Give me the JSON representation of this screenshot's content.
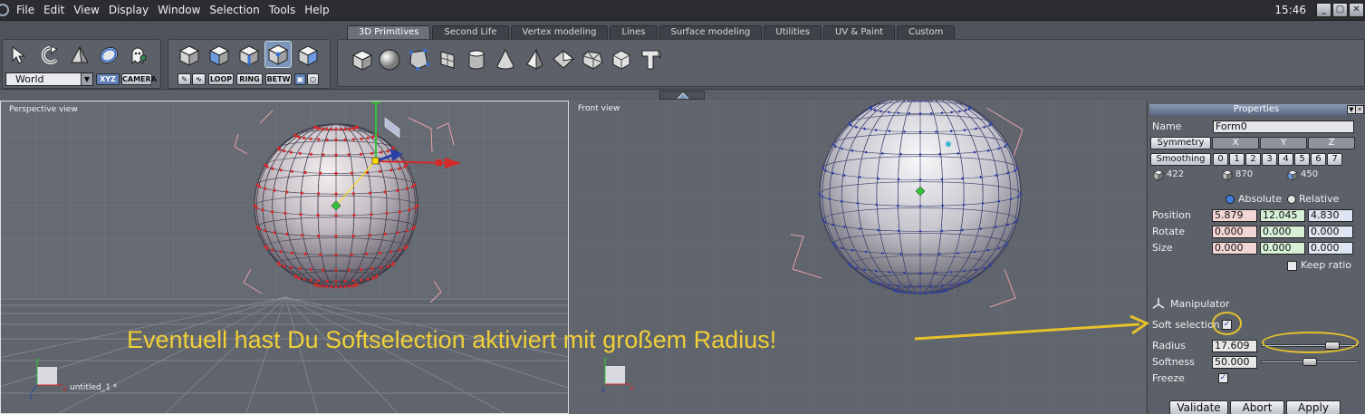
{
  "menubar": {
    "items": [
      "File",
      "Edit",
      "View",
      "Display",
      "Window",
      "Selection",
      "Tools",
      "Help"
    ],
    "clock": "15:46",
    "window_buttons": [
      "_",
      "▢",
      "✕"
    ]
  },
  "toolbar": {
    "tabs": [
      "3D Primitives",
      "Second Life",
      "Vertex modeling",
      "Lines",
      "Surface modeling",
      "Utilities",
      "UV & Paint",
      "Custom"
    ],
    "active_tab": "3D Primitives",
    "coord_space": "World",
    "xyz_label": "XYZ",
    "camera_label": "CAMERA",
    "loop_label": "LOOP",
    "ring_label": "RING",
    "betw_label": "BETW",
    "nav_icons": [
      "arrow-select-icon",
      "rotate-icon",
      "tetra-icon",
      "sphere-select-icon",
      "ghost-icon"
    ],
    "selection_icons": [
      "cube-object-icon",
      "cube-face-icon",
      "cube-edge-icon",
      "cube-vertex-icon",
      "cube-all-icon"
    ],
    "primitive_icons": [
      "cube-icon",
      "sphere-icon",
      "polygon-icon",
      "plane-icon",
      "cylinder-icon",
      "cone-icon",
      "pyramid-icon",
      "diamond-icon",
      "octahedron-icon",
      "icosahedron-icon",
      "text-icon"
    ]
  },
  "viewports": {
    "perspective": {
      "title": "Perspective view",
      "file_label": "untitled_1 *"
    },
    "front": {
      "title": "Front view"
    }
  },
  "properties": {
    "title": "Properties",
    "name_label": "Name",
    "name_value": "Form0",
    "symmetry_label": "Symmetry",
    "symmetry_axes": [
      "X",
      "Y",
      "Z"
    ],
    "smoothing_label": "Smoothing",
    "smoothing_levels": [
      "0",
      "1",
      "2",
      "3",
      "4",
      "5",
      "6",
      "7"
    ],
    "counts": [
      "422",
      "870",
      "450"
    ],
    "absolute_label": "Absolute",
    "relative_label": "Relative",
    "position_label": "Position",
    "position": [
      "5.879",
      "12.045",
      "4.830"
    ],
    "rotate_label": "Rotate",
    "rotate": [
      "0.000",
      "0.000",
      "0.000"
    ],
    "size_label": "Size",
    "size": [
      "0.000",
      "0.000",
      "0.000"
    ],
    "keep_ratio_label": "Keep ratio",
    "manipulator_label": "Manipulator",
    "soft_selection_label": "Soft selection",
    "soft_selection_checked": true,
    "radius_label": "Radius",
    "radius_value": "17.609",
    "radius_level": 0.78,
    "softness_label": "Softness",
    "softness_value": "50.000",
    "softness_level": 0.5,
    "freeze_label": "Freeze",
    "freeze_checked": true,
    "validate_label": "Validate",
    "abort_label": "Abort",
    "apply_label": "Apply"
  },
  "annotation": {
    "text": "Eventuell hast Du Softselection aktiviert mit großem Radius!",
    "color": "#f0cf38"
  },
  "colors": {
    "accent": "#7c95b8",
    "selection_red": "#d42a2a",
    "selection_blue": "#2c3ea8",
    "axis_green": "#34c23a"
  }
}
